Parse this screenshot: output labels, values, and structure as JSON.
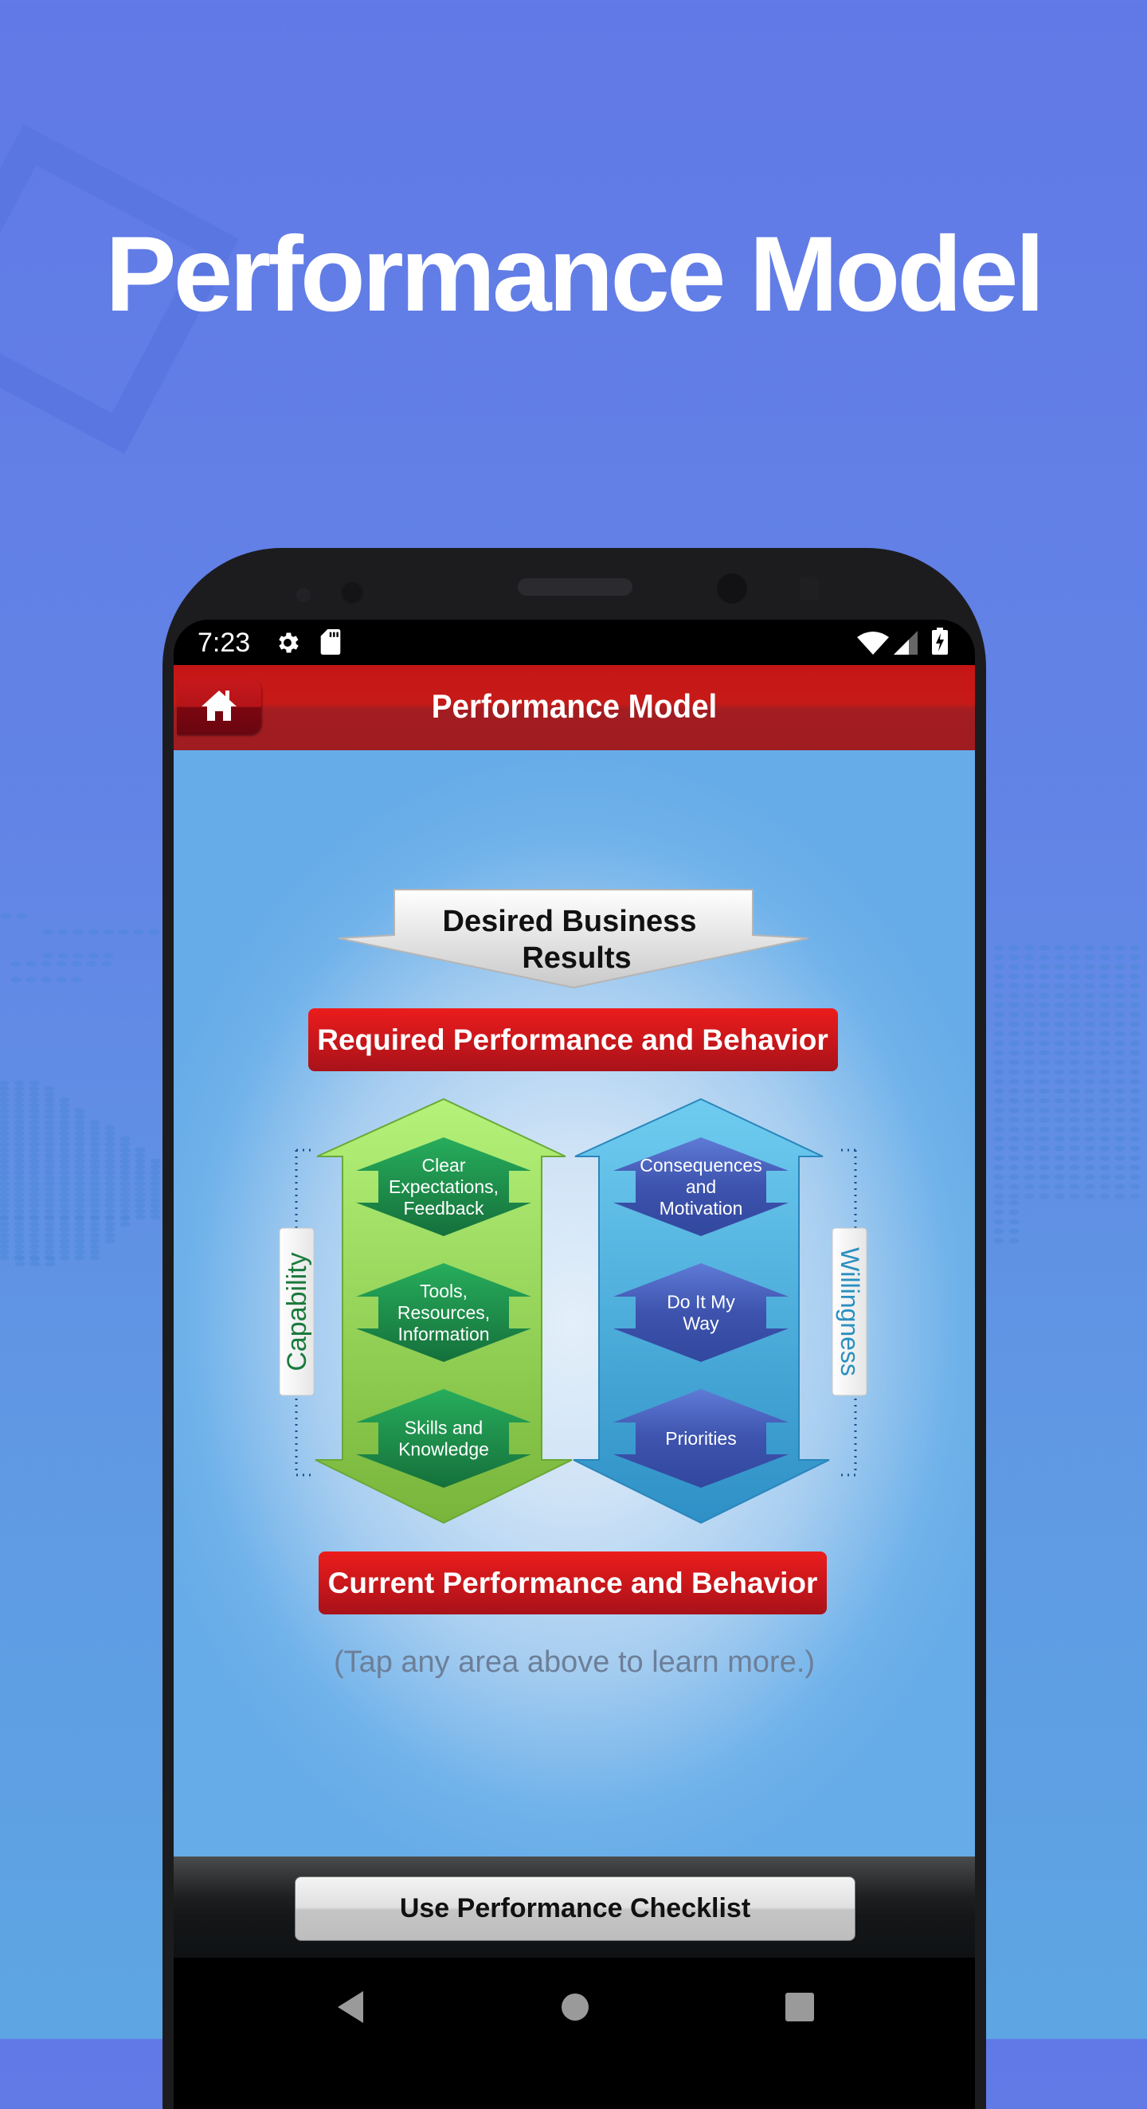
{
  "hero": {
    "title": "Performance Model"
  },
  "statusbar": {
    "time": "7:23",
    "left_icons": [
      "gear-icon",
      "sd-card-icon"
    ],
    "right_icons": [
      "wifi-icon",
      "cell-signal-icon",
      "battery-charging-icon"
    ]
  },
  "appbar": {
    "title": "Performance Model",
    "home_icon": "home-icon"
  },
  "diagram": {
    "desired": {
      "line1": "Desired Business",
      "line2": "Results"
    },
    "required_banner": "Required Performance and Behavior",
    "current_banner": "Current Performance and Behavior",
    "capability": {
      "label": "Capability",
      "items": [
        {
          "lines": [
            "Clear",
            "Expectations,",
            "Feedback"
          ]
        },
        {
          "lines": [
            "Tools,",
            "Resources,",
            "Information"
          ]
        },
        {
          "lines": [
            "Skills and",
            "Knowledge"
          ]
        }
      ]
    },
    "willingness": {
      "label": "Willingness",
      "items": [
        {
          "lines": [
            "Consequences",
            "and",
            "Motivation"
          ]
        },
        {
          "lines": [
            "Do It My",
            "Way"
          ]
        },
        {
          "lines": [
            "Priorities"
          ]
        }
      ]
    },
    "tap_hint": "(Tap any area above to learn more.)"
  },
  "bottom": {
    "checklist_button": "Use Performance Checklist"
  },
  "navbar": {
    "back": "back-icon",
    "home": "home-circle-icon",
    "recents": "recents-icon"
  },
  "colors": {
    "brand_red": "#c41616",
    "capability_green": "#1f9950",
    "willingness_blue": "#3c52ad",
    "capability_label": "#1a7a3c",
    "willingness_label": "#2a90c0"
  }
}
